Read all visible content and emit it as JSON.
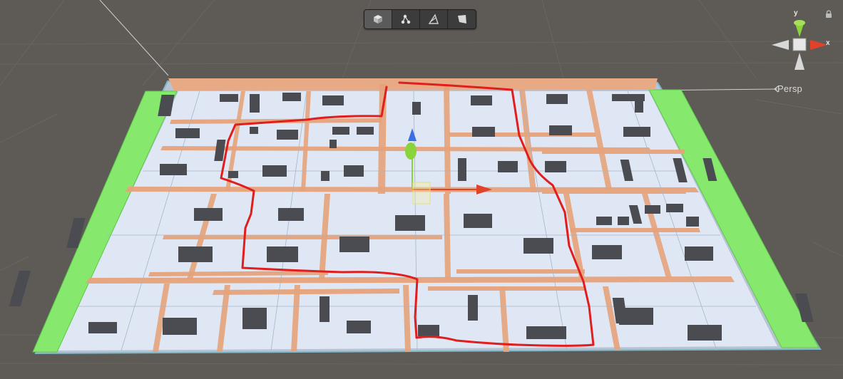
{
  "scene_view": {
    "projection_label": "Persp",
    "axis_labels": {
      "y": "y",
      "x": "x"
    },
    "toolbar": {
      "buttons": [
        {
          "name": "shaded-mode",
          "icon": "cube-icon",
          "active": true
        },
        {
          "name": "nav-graph",
          "icon": "nodes-icon",
          "active": false
        },
        {
          "name": "path-tool",
          "icon": "triangle-path-icon",
          "active": false
        },
        {
          "name": "surface-tool",
          "icon": "quad-plane-icon",
          "active": false
        }
      ]
    },
    "colors": {
      "background": "#5e5a56",
      "floor": "#dfe7f4",
      "walls": "#e6a37b",
      "edge_strips": "#86e86c",
      "furniture": "#4a4c52",
      "annotation": "#e01e1e",
      "gizmo_x": "#e0432a",
      "gizmo_y": "#8ad33a",
      "gizmo_z": "#3a6fe0"
    }
  }
}
